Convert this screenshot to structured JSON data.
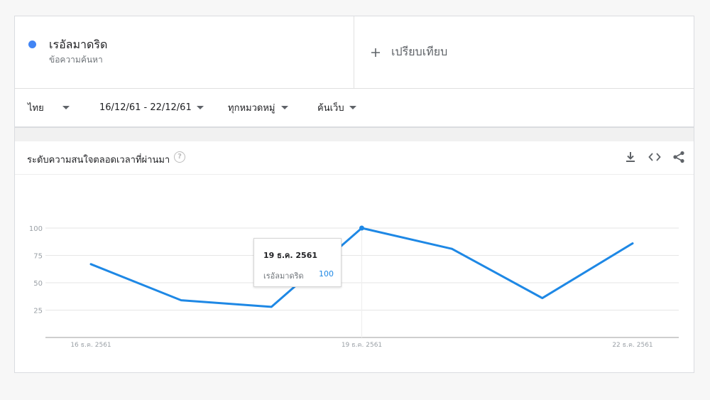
{
  "colors": {
    "series": "#1e88e5",
    "dot": "#4285f4",
    "grid": "#e6e6e6",
    "axis": "#9e9e9e",
    "tick_label": "#9aa0a6"
  },
  "term": {
    "name": "เรอัลมาดริด",
    "type": "ข้อความค้นหา"
  },
  "compare": {
    "label": "เปรียบเทียบ",
    "icon": "plus-icon"
  },
  "filters": {
    "region": "ไทย",
    "date_range": "16/12/61 - 22/12/61",
    "category": "ทุกหมวดหมู่",
    "search_type": "ค้นเว็บ"
  },
  "panel": {
    "title": "ระดับความสนใจตลอดเวลาที่ผ่านมา",
    "help_icon": "help-icon",
    "help_glyph": "?",
    "tools": [
      "download-icon",
      "embed-icon",
      "share-icon"
    ]
  },
  "chart_data": {
    "type": "line",
    "x": [
      "16 ธ.ค. 2561",
      "17 ธ.ค. 2561",
      "18 ธ.ค. 2561",
      "19 ธ.ค. 2561",
      "20 ธ.ค. 2561",
      "21 ธ.ค. 2561",
      "22 ธ.ค. 2561"
    ],
    "x_tick_labels": [
      "16 ธ.ค. 2561",
      "19 ธ.ค. 2561",
      "22 ธ.ค. 2561"
    ],
    "y_ticks": [
      25,
      50,
      75,
      100
    ],
    "ylim": [
      0,
      100
    ],
    "grid": true,
    "series": [
      {
        "name": "เรอัลมาดริด",
        "values": [
          67,
          34,
          28,
          100,
          81,
          36,
          86
        ]
      }
    ],
    "highlight_index": 3,
    "tooltip": {
      "date": "19 ธ.ค. 2561",
      "series": "เรอัลมาดริด",
      "value": "100"
    }
  }
}
